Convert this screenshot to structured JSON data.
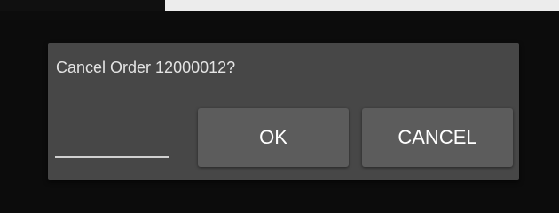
{
  "dialog": {
    "message": "Cancel Order 12000012?",
    "input_value": "",
    "ok_label": "OK",
    "cancel_label": "CANCEL"
  },
  "colors": {
    "background": "#0c0c0c",
    "dialog_bg": "#474747",
    "button_bg": "#5c5c5c",
    "text": "#ffffff"
  }
}
